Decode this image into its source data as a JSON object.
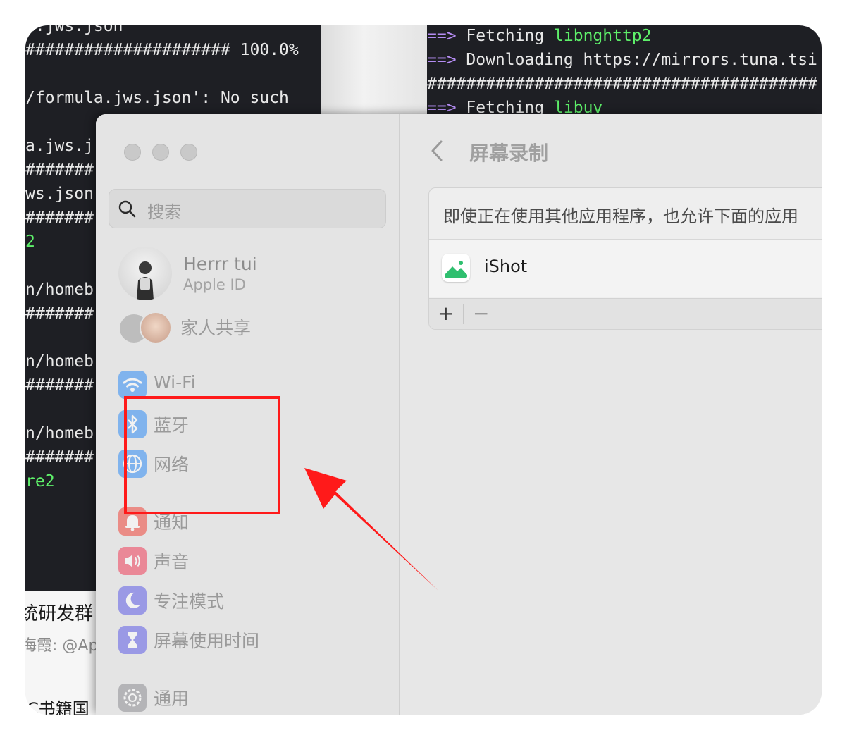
{
  "terminal_left": {
    "lines": [
      {
        "text": "a.jws.json",
        "color": "default"
      },
      {
        "text": "##################### 100.0%",
        "color": "default"
      },
      {
        "text": "",
        "color": "default"
      },
      {
        "text": "/formula.jws.json': No such",
        "color": "default"
      },
      {
        "text": "",
        "color": "default"
      },
      {
        "text": "a.jws.j",
        "color": "default"
      },
      {
        "text": "#######",
        "color": "default"
      },
      {
        "text": "ws.json",
        "color": "default"
      },
      {
        "text": "#######",
        "color": "default"
      },
      {
        "text": "2",
        "color": "green"
      },
      {
        "text": "",
        "color": "default"
      },
      {
        "text": "n/homeb",
        "color": "default"
      },
      {
        "text": "#######",
        "color": "default"
      },
      {
        "text": "",
        "color": "default"
      },
      {
        "text": "n/homeb",
        "color": "default"
      },
      {
        "text": "#######",
        "color": "default"
      },
      {
        "text": "",
        "color": "default"
      },
      {
        "text": "n/homeb",
        "color": "default"
      },
      {
        "text": "#######",
        "color": "default"
      },
      {
        "text": "re2",
        "color": "green"
      }
    ]
  },
  "terminal_right": {
    "line1_arrow": "==>",
    "line1_text": " Fetching ",
    "line1_pkg": "libnghttp2",
    "line2_arrow": "==>",
    "line2_text": " Downloading https://mirrors.tuna.tsi",
    "line3": "########################################",
    "line4_arrow": "==>",
    "line4_text": " Fetching ",
    "line4_pkg": "libuv"
  },
  "behind_text": {
    "line1": "统研发群",
    "line2": "海霞: @Ap",
    "line3": "C书籍国"
  },
  "settings": {
    "search_placeholder": "搜索",
    "account": {
      "name": "Herrr tui",
      "sub": "Apple ID"
    },
    "family_label": "家人共享",
    "sidebar_items": [
      {
        "label": "Wi-Fi",
        "icon": "wifi-icon",
        "color": "#2f8cf5"
      },
      {
        "label": "蓝牙",
        "icon": "bluetooth-icon",
        "color": "#2f8cf5"
      },
      {
        "label": "网络",
        "icon": "globe-icon",
        "color": "#2f8cf5"
      },
      {
        "label": "通知",
        "icon": "bell-icon",
        "color": "#f0453a"
      },
      {
        "label": "声音",
        "icon": "speaker-icon",
        "color": "#ef3d5a"
      },
      {
        "label": "专注模式",
        "icon": "moon-icon",
        "color": "#5e5ce6"
      },
      {
        "label": "屏幕使用时间",
        "icon": "hourglass-icon",
        "color": "#5e5ce6"
      },
      {
        "label": "通用",
        "icon": "gear-icon",
        "color": "#8e8e93"
      }
    ],
    "page_title": "屏幕录制",
    "description": "即使正在使用其他应用程序，也允许下面的应用",
    "apps": [
      {
        "name": "iShot"
      }
    ],
    "add_label": "+",
    "remove_label": "−"
  },
  "annotation_color": "#ff1a1a"
}
